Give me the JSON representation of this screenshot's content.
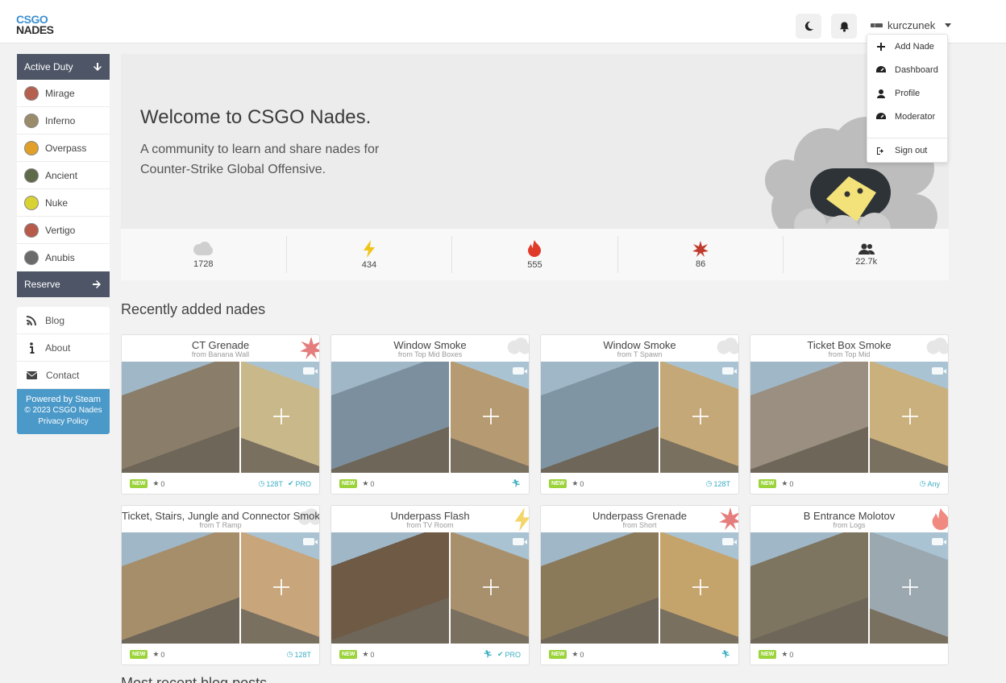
{
  "header": {
    "logo_line1": "CSGO",
    "logo_line2": "NADES",
    "username": "kurczunek"
  },
  "user_menu": {
    "items": [
      {
        "label": "Add Nade",
        "icon": "plus-icon"
      },
      {
        "label": "Dashboard",
        "icon": "dashboard-icon"
      },
      {
        "label": "Profile",
        "icon": "user-icon"
      },
      {
        "label": "Moderator",
        "icon": "dashboard-icon"
      },
      {
        "label": "Sign out",
        "icon": "sign-out-icon"
      }
    ]
  },
  "sidebar": {
    "active_duty_label": "Active Duty",
    "maps": [
      {
        "label": "Mirage",
        "color": "#b5604f"
      },
      {
        "label": "Inferno",
        "color": "#9a8b6a"
      },
      {
        "label": "Overpass",
        "color": "#e0a02a"
      },
      {
        "label": "Ancient",
        "color": "#5f6a48"
      },
      {
        "label": "Nuke",
        "color": "#d9d233"
      },
      {
        "label": "Vertigo",
        "color": "#b85a4a"
      },
      {
        "label": "Anubis",
        "color": "#6a6a6a"
      }
    ],
    "reserve_label": "Reserve",
    "links": [
      {
        "label": "Blog",
        "icon": "rss-icon"
      },
      {
        "label": "About",
        "icon": "info-icon"
      },
      {
        "label": "Contact",
        "icon": "mail-icon"
      }
    ],
    "footer": {
      "line1": "Powered by Steam",
      "line2": "© 2023 CSGO Nades",
      "line3": "Privacy Policy"
    }
  },
  "hero": {
    "title": "Welcome to CSGO Nades.",
    "subtitle": "A community to learn and share nades for Counter-Strike Global Offensive."
  },
  "stats": [
    {
      "icon": "smoke-icon",
      "value": "1728",
      "color": "#cfcfcf"
    },
    {
      "icon": "flash-icon",
      "value": "434",
      "color": "#f0c419"
    },
    {
      "icon": "molotov-icon",
      "value": "555",
      "color": "#e03b2a"
    },
    {
      "icon": "grenade-icon",
      "value": "86",
      "color": "#c0392b"
    },
    {
      "icon": "users-icon",
      "value": "22.7k",
      "color": "#333333"
    }
  ],
  "recent": {
    "title": "Recently added nades",
    "next_title": "Most recent blog posts",
    "cards": [
      {
        "title": "CT Grenade",
        "from": "from Banana Wall",
        "type": "grenade",
        "badge": "NEW",
        "stars": "0",
        "tick": "128T",
        "pro": "PRO",
        "running": false,
        "colors": [
          "#8a7e6a",
          "#c9b88a"
        ]
      },
      {
        "title": "Window Smoke",
        "from": "from Top Mid Boxes",
        "type": "smoke",
        "badge": "NEW",
        "stars": "0",
        "tick": "",
        "pro": "",
        "running": true,
        "colors": [
          "#7b8f9e",
          "#b69a72"
        ]
      },
      {
        "title": "Window Smoke",
        "from": "from T Spawn",
        "type": "smoke",
        "badge": "NEW",
        "stars": "0",
        "tick": "128T",
        "pro": "",
        "running": false,
        "colors": [
          "#7f95a3",
          "#c4a877"
        ]
      },
      {
        "title": "Ticket Box Smoke",
        "from": "from Top Mid",
        "type": "smoke",
        "badge": "NEW",
        "stars": "0",
        "tick": "Any",
        "pro": "",
        "running": false,
        "colors": [
          "#9a8f80",
          "#c9b07c"
        ]
      },
      {
        "title": "Ticket, Stairs, Jungle and Connector Smoke",
        "from": "from T Ramp",
        "type": "smoke",
        "badge": "NEW",
        "stars": "0",
        "tick": "128T",
        "pro": "",
        "running": false,
        "colors": [
          "#a68e6b",
          "#c8a57a"
        ]
      },
      {
        "title": "Underpass Flash",
        "from": "from TV Room",
        "type": "flash",
        "badge": "NEW",
        "stars": "0",
        "tick": "",
        "pro": "PRO",
        "running": true,
        "colors": [
          "#6e5a45",
          "#a9906c"
        ]
      },
      {
        "title": "Underpass Grenade",
        "from": "from Short",
        "type": "grenade",
        "badge": "NEW",
        "stars": "0",
        "tick": "",
        "pro": "",
        "running": true,
        "colors": [
          "#8a7a5a",
          "#c5a46b"
        ]
      },
      {
        "title": "B Entrance Molotov",
        "from": "from Logs",
        "type": "molotov",
        "badge": "NEW",
        "stars": "0",
        "tick": "",
        "pro": "",
        "running": false,
        "colors": [
          "#7d7560",
          "#9ba8b0"
        ]
      }
    ]
  }
}
